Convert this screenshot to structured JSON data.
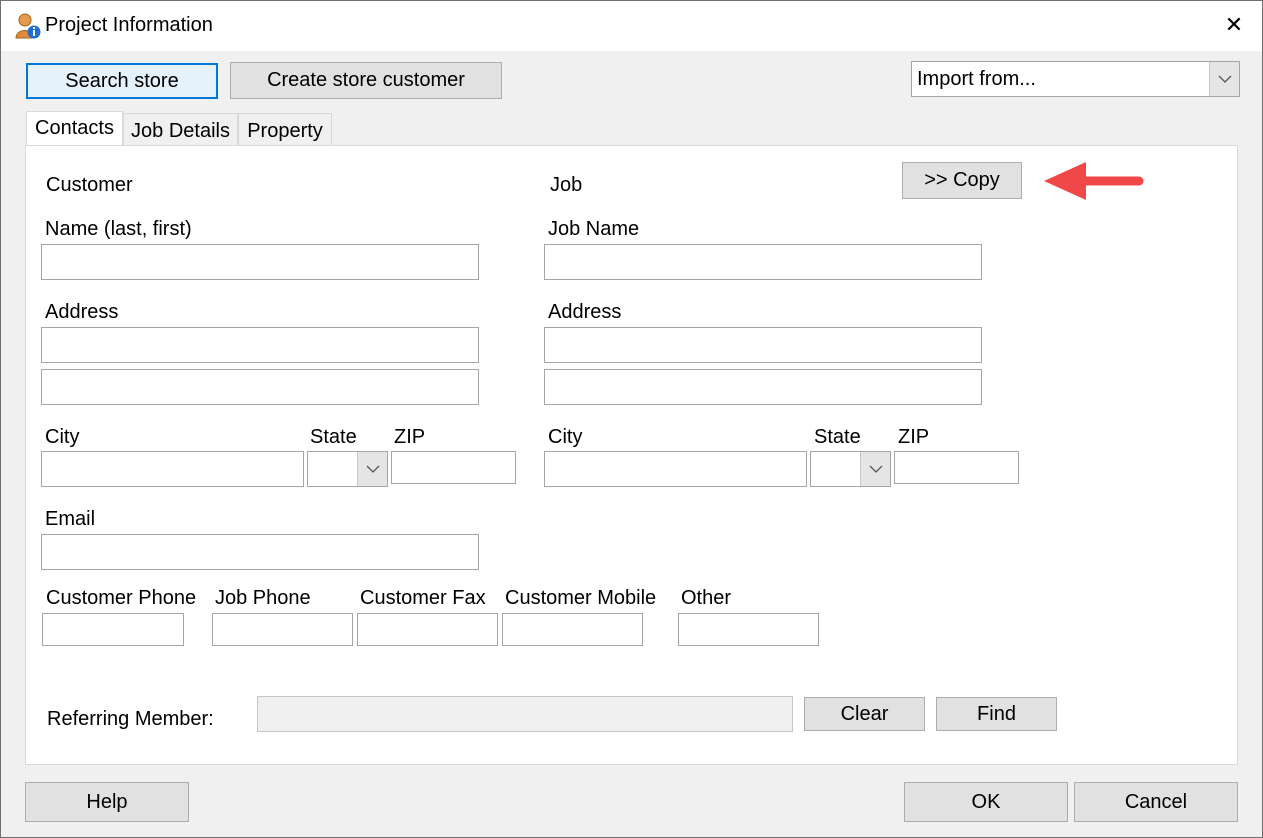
{
  "window": {
    "title": "Project Information"
  },
  "toolbar": {
    "search_store": "Search store",
    "create_store_customer": "Create store customer",
    "import_placeholder": "Import from..."
  },
  "tabs": [
    {
      "label": "Contacts",
      "active": true
    },
    {
      "label": "Job Details",
      "active": false
    },
    {
      "label": "Property",
      "active": false
    }
  ],
  "contacts": {
    "customer_heading": "Customer",
    "job_heading": "Job",
    "copy_button": ">> Copy",
    "customer_name_label": "Name (last, first)",
    "job_name_label": "Job Name",
    "address_label": "Address",
    "city_label": "City",
    "state_label": "State",
    "zip_label": "ZIP",
    "email_label": "Email",
    "customer_phone_label": "Customer Phone",
    "job_phone_label": "Job Phone",
    "customer_fax_label": "Customer Fax",
    "customer_mobile_label": "Customer Mobile",
    "other_label": "Other",
    "referring_member_label": "Referring Member:",
    "clear_button": "Clear",
    "find_button": "Find"
  },
  "footer": {
    "help": "Help",
    "ok": "OK",
    "cancel": "Cancel"
  },
  "colors": {
    "accent": "#0078d7",
    "annotation_arrow": "#f04848"
  }
}
